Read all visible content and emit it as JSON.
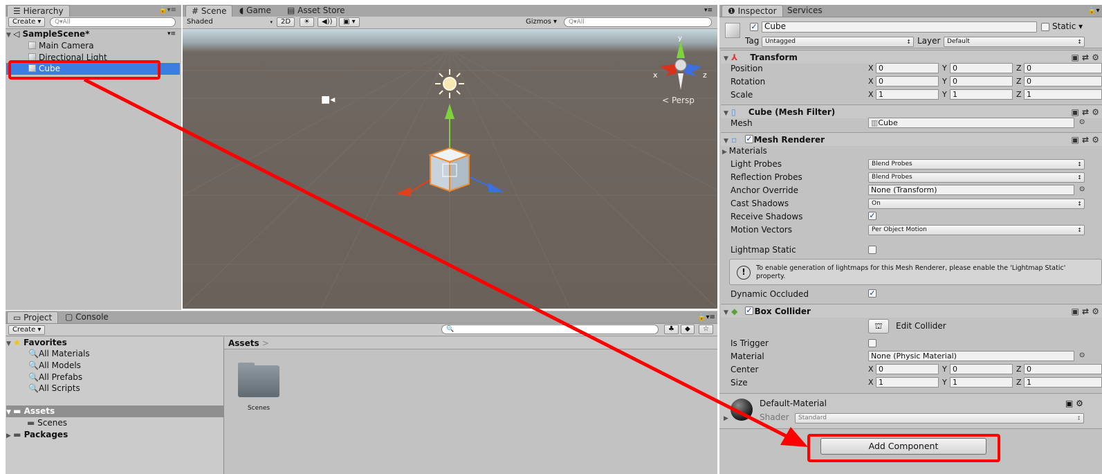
{
  "hierarchy": {
    "tab_label": "Hierarchy",
    "create_label": "Create",
    "search_placeholder": "Q▾All",
    "scene_name": "SampleScene*",
    "items": [
      "Main Camera",
      "Directional Light",
      "Cube"
    ]
  },
  "scene": {
    "tabs": [
      "Scene",
      "Game",
      "Asset Store"
    ],
    "shading_mode": "Shaded",
    "mode_2d": "2D",
    "gizmos_label": "Gizmos",
    "search_placeholder": "Q▾All",
    "persp_label": "< Persp",
    "axis_x": "x",
    "axis_y": "y",
    "axis_z": "z"
  },
  "project": {
    "tabs": [
      "Project",
      "Console"
    ],
    "create_label": "Create",
    "favorites_label": "Favorites",
    "favorites": [
      "All Materials",
      "All Models",
      "All Prefabs",
      "All Scripts"
    ],
    "assets_label": "Assets",
    "assets_children": [
      "Scenes"
    ],
    "packages_label": "Packages",
    "breadcrumb": "Assets",
    "folder_name": "Scenes"
  },
  "inspector": {
    "tabs": [
      "Inspector",
      "Services"
    ],
    "object_name": "Cube",
    "static_label": "Static",
    "tag_label": "Tag",
    "tag_value": "Untagged",
    "layer_label": "Layer",
    "layer_value": "Default",
    "transform": {
      "title": "Transform",
      "rows": [
        {
          "label": "Position",
          "x": "0",
          "y": "0",
          "z": "0"
        },
        {
          "label": "Rotation",
          "x": "0",
          "y": "0",
          "z": "0"
        },
        {
          "label": "Scale",
          "x": "1",
          "y": "1",
          "z": "1"
        }
      ]
    },
    "mesh_filter": {
      "title": "Cube (Mesh Filter)",
      "mesh_label": "Mesh",
      "mesh_value": "Cube"
    },
    "mesh_renderer": {
      "title": "Mesh Renderer",
      "materials_label": "Materials",
      "light_probes_label": "Light Probes",
      "light_probes_value": "Blend Probes",
      "reflection_probes_label": "Reflection Probes",
      "reflection_probes_value": "Blend Probes",
      "anchor_override_label": "Anchor Override",
      "anchor_override_value": "None (Transform)",
      "cast_shadows_label": "Cast Shadows",
      "cast_shadows_value": "On",
      "receive_shadows_label": "Receive Shadows",
      "motion_vectors_label": "Motion Vectors",
      "motion_vectors_value": "Per Object Motion",
      "lightmap_static_label": "Lightmap Static",
      "info_text_1": "To enable generation of lightmaps for this Mesh Renderer, please enable the 'Lightmap Static'",
      "info_text_2": "property.",
      "dynamic_occluded_label": "Dynamic Occluded"
    },
    "box_collider": {
      "title": "Box Collider",
      "edit_collider_label": "Edit Collider",
      "is_trigger_label": "Is Trigger",
      "material_label": "Material",
      "material_value": "None (Physic Material)",
      "center_label": "Center",
      "center": {
        "x": "0",
        "y": "0",
        "z": "0"
      },
      "size_label": "Size",
      "size": {
        "x": "1",
        "y": "1",
        "z": "1"
      }
    },
    "material": {
      "name": "Default-Material",
      "shader_label": "Shader",
      "shader_value": "Standard"
    },
    "add_component_label": "Add Component",
    "axis_labels": {
      "x": "X",
      "y": "Y",
      "z": "Z"
    }
  },
  "colors": {
    "selection": "#3b7de0",
    "annotation": "#ff0000",
    "panel": "#c2c2c2",
    "scene_ground": "#6b625b"
  }
}
